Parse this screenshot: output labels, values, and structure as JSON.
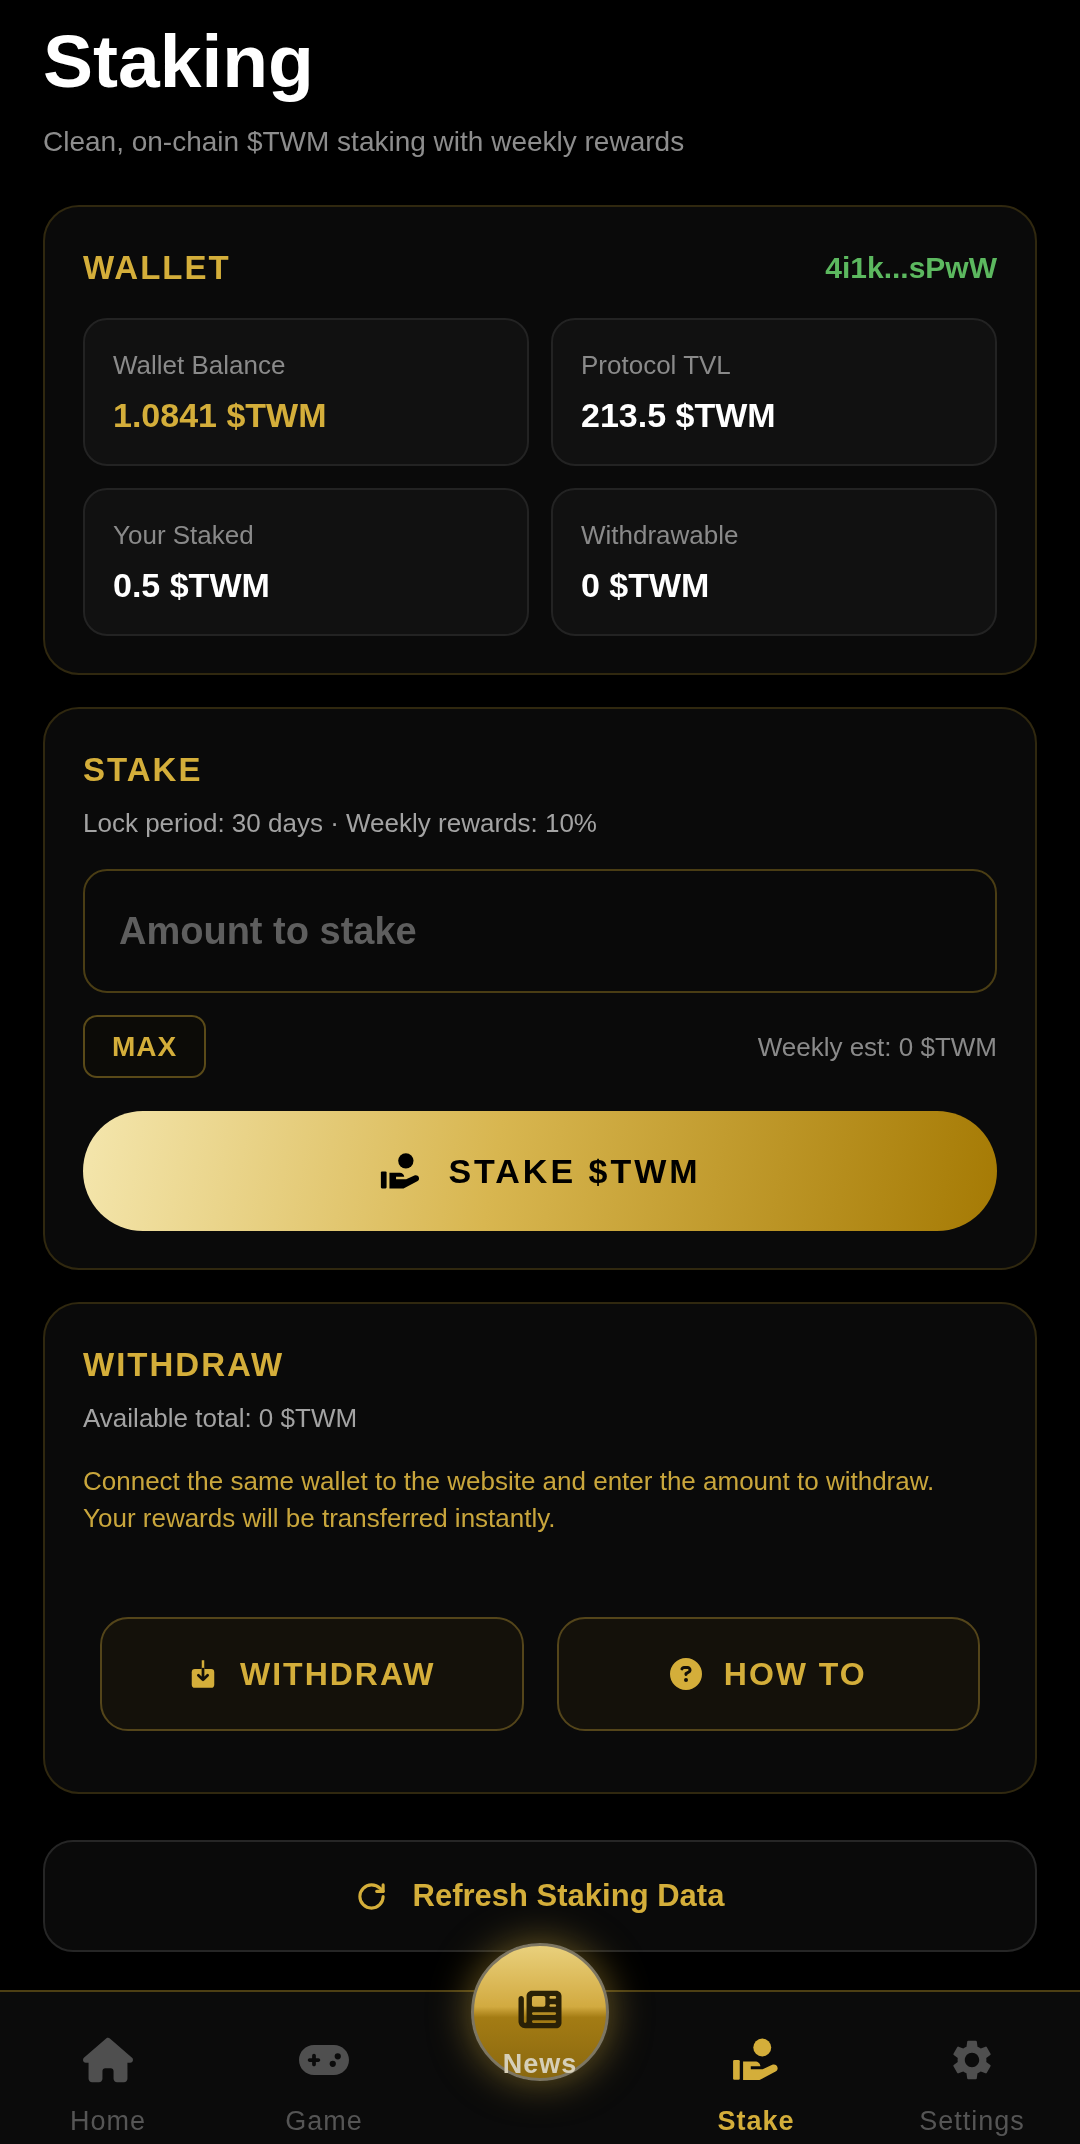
{
  "header": {
    "title": "Staking",
    "subtitle": "Clean, on-chain $TWM staking with weekly rewards"
  },
  "wallet": {
    "title": "WALLET",
    "address": "4i1k...sPwW",
    "stats": [
      {
        "label": "Wallet Balance",
        "value": "1.0841 $TWM",
        "highlighted": true
      },
      {
        "label": "Protocol TVL",
        "value": "213.5 $TWM",
        "highlighted": false
      },
      {
        "label": "Your Staked",
        "value": "0.5 $TWM",
        "highlighted": false
      },
      {
        "label": "Withdrawable",
        "value": "0 $TWM",
        "highlighted": false
      }
    ]
  },
  "stake": {
    "title": "STAKE",
    "info": "Lock period: 30 days · Weekly rewards: 10%",
    "amount_field": {
      "placeholder": "Amount to stake"
    },
    "max_button": "MAX",
    "estimate": "Weekly est: 0 $TWM",
    "stake_button": "STAKE $TWM"
  },
  "withdraw": {
    "title": "WITHDRAW",
    "available": "Available total: 0 $TWM",
    "note": "Connect the same wallet to the website and enter the amount to withdraw. Your rewards will be transferred instantly.",
    "buttons": [
      {
        "label": "WITHDRAW",
        "kind": "withdraw"
      },
      {
        "label": "HOW TO",
        "kind": "help"
      }
    ]
  },
  "refresh_button": "Refresh Staking Data",
  "bottom_nav": [
    {
      "label": "Home",
      "kind": "home",
      "selected": false
    },
    {
      "label": "Game",
      "kind": "game",
      "selected": false
    },
    {
      "label": "News",
      "kind": "news",
      "selected": false
    },
    {
      "label": "Stake",
      "kind": "stake",
      "selected": true
    },
    {
      "label": "Settings",
      "kind": "settings",
      "selected": false
    }
  ]
}
